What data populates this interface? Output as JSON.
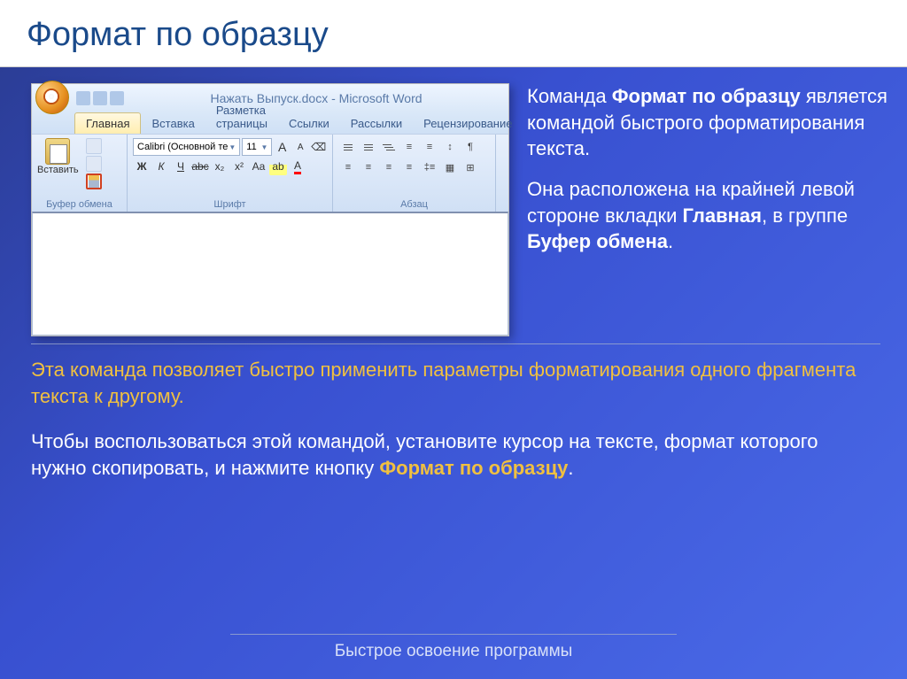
{
  "title": "Формат по образцу",
  "word": {
    "doc_title": "Нажать Выпуск.docx - Microsoft Word",
    "tabs": [
      "Главная",
      "Вставка",
      "Разметка страницы",
      "Ссылки",
      "Рассылки",
      "Рецензирование"
    ],
    "paste_label": "Вставить",
    "clipboard_label": "Буфер обмена",
    "font_name": "Calibri (Основной те",
    "font_size": "11",
    "font_label": "Шрифт",
    "para_label": "Абзац"
  },
  "side": {
    "p1_a": "Команда ",
    "p1_b": "Формат по образцу",
    "p1_c": " является командой быстрого форматирования текста.",
    "p2_a": "Она расположена на крайней левой стороне вкладки ",
    "p2_b": "Главная",
    "p2_c": ", в группе ",
    "p2_d": "Буфер обмена",
    "p2_e": "."
  },
  "lower": {
    "p1": "Эта команда позволяет быстро применить параметры форматирования одного фрагмента текста к другому.",
    "p2_a": "Чтобы воспользоваться этой командой, установите курсор на тексте, формат которого нужно скопировать, и нажмите кнопку ",
    "p2_b": "Формат по образцу",
    "p2_c": "."
  },
  "footer": "Быстрое освоение программы"
}
